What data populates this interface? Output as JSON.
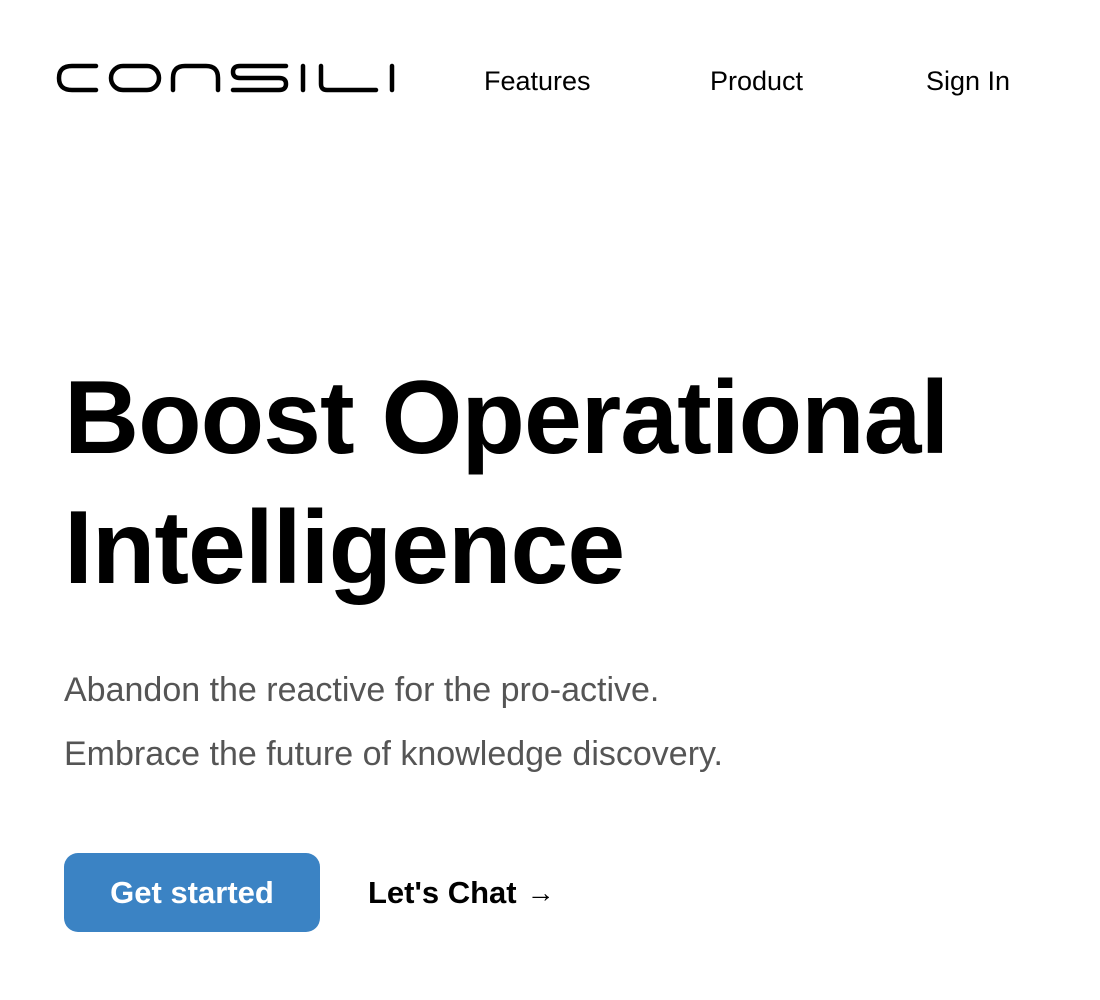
{
  "brand": {
    "logo_text": "CONSILI"
  },
  "nav": {
    "items": [
      {
        "label": "Features"
      },
      {
        "label": "Product"
      },
      {
        "label": "Sign In"
      }
    ]
  },
  "hero": {
    "headline_line1": "Boost Operational",
    "headline_line2": "Intelligence",
    "subtitle_line1": "Abandon the reactive for the pro-active.",
    "subtitle_line2": "Embrace the future of knowledge discovery.",
    "primary_cta": "Get started",
    "secondary_cta": "Let's Chat",
    "secondary_cta_icon": "arrow-right-icon"
  },
  "colors": {
    "primary_button": "#3b83c4",
    "subtitle_text": "#555555",
    "text": "#000000",
    "background": "#ffffff"
  }
}
